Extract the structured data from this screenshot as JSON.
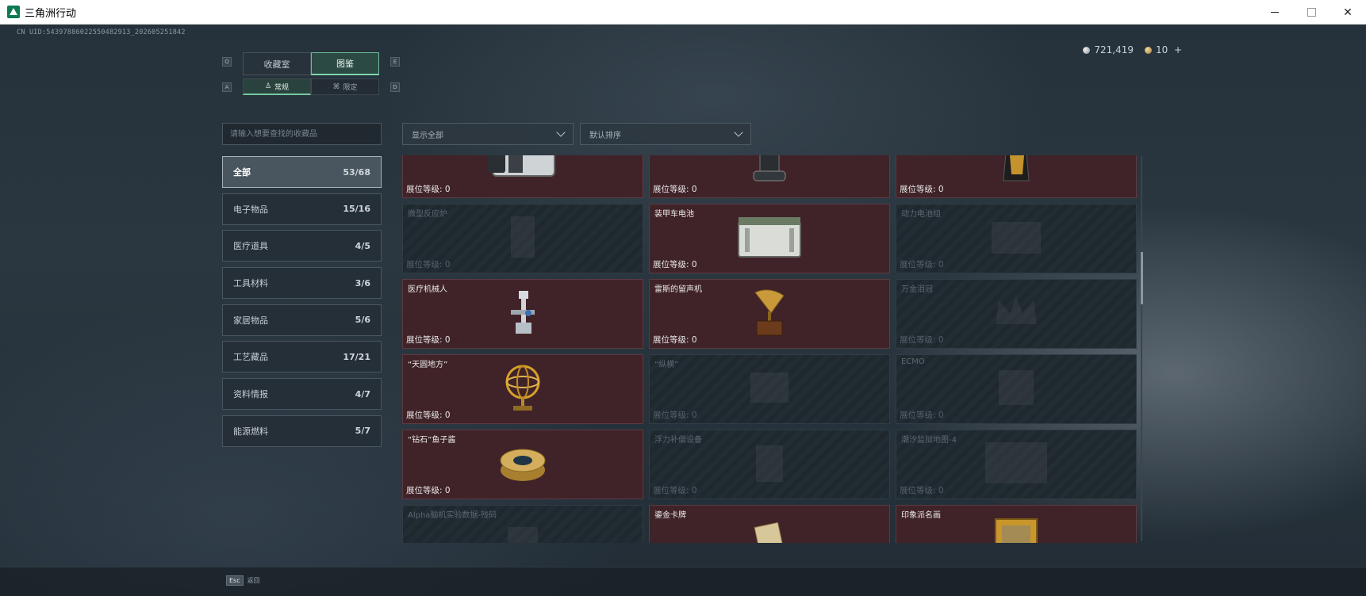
{
  "window": {
    "title": "三角洲行动",
    "minimize_label": "",
    "maximize_label": "",
    "close_label": "✕"
  },
  "uid": "CN UID:543978860225504829​13_202605251842",
  "currency": {
    "silver": "721,419",
    "gold": "10",
    "add": "+"
  },
  "tabs": [
    {
      "label": "收藏室",
      "active": false
    },
    {
      "label": "图鉴",
      "active": true
    }
  ],
  "tab_keys": {
    "left": "Q",
    "right": "E",
    "sub_left": "A",
    "sub_right": "D"
  },
  "subtabs": [
    {
      "label": "常规",
      "active": true
    },
    {
      "label": "限定",
      "active": false
    }
  ],
  "search": {
    "placeholder": "请输入想要查找的收藏品",
    "value": ""
  },
  "filters": {
    "display": "显示全部",
    "sort": "默认排序"
  },
  "categories": [
    {
      "label": "全部",
      "count": "53/68",
      "active": true
    },
    {
      "label": "电子物品",
      "count": "15/16"
    },
    {
      "label": "医疗道具",
      "count": "4/5"
    },
    {
      "label": "工具材料",
      "count": "3/6"
    },
    {
      "label": "家居物品",
      "count": "5/6"
    },
    {
      "label": "工艺藏品",
      "count": "17/21"
    },
    {
      "label": "资料情报",
      "count": "4/7"
    },
    {
      "label": "能源燃料",
      "count": "5/7"
    }
  ],
  "cards": [
    {
      "name": "",
      "level": "展位等级: 0",
      "owned": true,
      "icon": "camera-icon"
    },
    {
      "name": "",
      "level": "展位等级: 0",
      "owned": true,
      "icon": "robot-vacuum-icon"
    },
    {
      "name": "",
      "level": "展位等级: 0",
      "owned": true,
      "icon": "coffee-bag-icon"
    },
    {
      "name": "微型反应炉",
      "level": "展位等级: 0",
      "owned": false,
      "icon": "reactor-icon"
    },
    {
      "name": "装甲车电池",
      "level": "展位等级: 0",
      "owned": true,
      "icon": "battery-icon"
    },
    {
      "name": "动力电池组",
      "level": "展位等级: 0",
      "owned": false,
      "icon": "battery-pack-icon"
    },
    {
      "name": "医疗机械人",
      "level": "展位等级: 0",
      "owned": true,
      "icon": "medical-robot-icon"
    },
    {
      "name": "雷斯的留声机",
      "level": "展位等级: 0",
      "owned": true,
      "icon": "gramophone-icon"
    },
    {
      "name": "万金泪冠",
      "level": "展位等级: 0",
      "owned": false,
      "icon": "crown-icon"
    },
    {
      "name": "“天圆地方”",
      "level": "展位等级: 0",
      "owned": true,
      "icon": "armillary-sphere-icon"
    },
    {
      "name": "“纵横”",
      "level": "展位等级: 0",
      "owned": false,
      "icon": "game-board-icon"
    },
    {
      "name": "ECMO",
      "level": "展位等级: 0",
      "owned": false,
      "icon": "ecmo-machine-icon"
    },
    {
      "name": "“钻石”鱼子酱",
      "level": "展位等级: 0",
      "owned": true,
      "icon": "caviar-tin-icon"
    },
    {
      "name": "浮力补偿设备",
      "level": "展位等级: 0",
      "owned": false,
      "icon": "bcd-vest-icon"
    },
    {
      "name": "潮汐监狱地图-4",
      "level": "展位等级: 0",
      "owned": false,
      "icon": "map-icon"
    },
    {
      "name": "Alpha脑机实验数据-残码",
      "level": "展位等级: 0",
      "owned": false,
      "icon": "data-chip-icon"
    },
    {
      "name": "鎏金卡牌",
      "level": "展位等级: 0",
      "owned": true,
      "icon": "gold-card-icon"
    },
    {
      "name": "印象派名画",
      "level": "展位等级: 0",
      "owned": true,
      "icon": "painting-icon"
    }
  ],
  "footer": {
    "esc_key": "Esc",
    "esc_label": "返回"
  }
}
